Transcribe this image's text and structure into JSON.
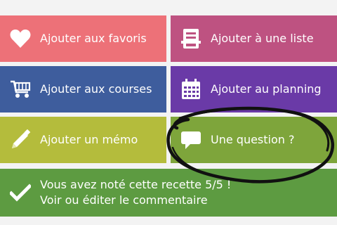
{
  "tiles": {
    "favorites": {
      "label": "Ajouter aux favoris",
      "color": "#ed7178",
      "icon": "heart-icon"
    },
    "list": {
      "label": "Ajouter à une liste",
      "color": "#be5281",
      "icon": "list-box-icon"
    },
    "shopping": {
      "label": "Ajouter aux courses",
      "color": "#3e5d9d",
      "icon": "cart-icon"
    },
    "planning": {
      "label": "Ajouter au planning",
      "color": "#6a3aa7",
      "icon": "calendar-icon"
    },
    "memo": {
      "label": "Ajouter un mémo",
      "color": "#b4bc3c",
      "icon": "pencil-icon"
    },
    "question": {
      "label": "Une question ?",
      "color": "#7ea53b",
      "icon": "speech-bubble-icon"
    },
    "rating": {
      "line1": "Vous avez noté cette recette 5/5 !",
      "line2": "Voir ou éditer le commentaire",
      "color": "#5d9b41",
      "icon": "checkmark-icon"
    }
  },
  "annotation": {
    "type": "hand-drawn-circle",
    "color": "#111111",
    "target": "question"
  }
}
